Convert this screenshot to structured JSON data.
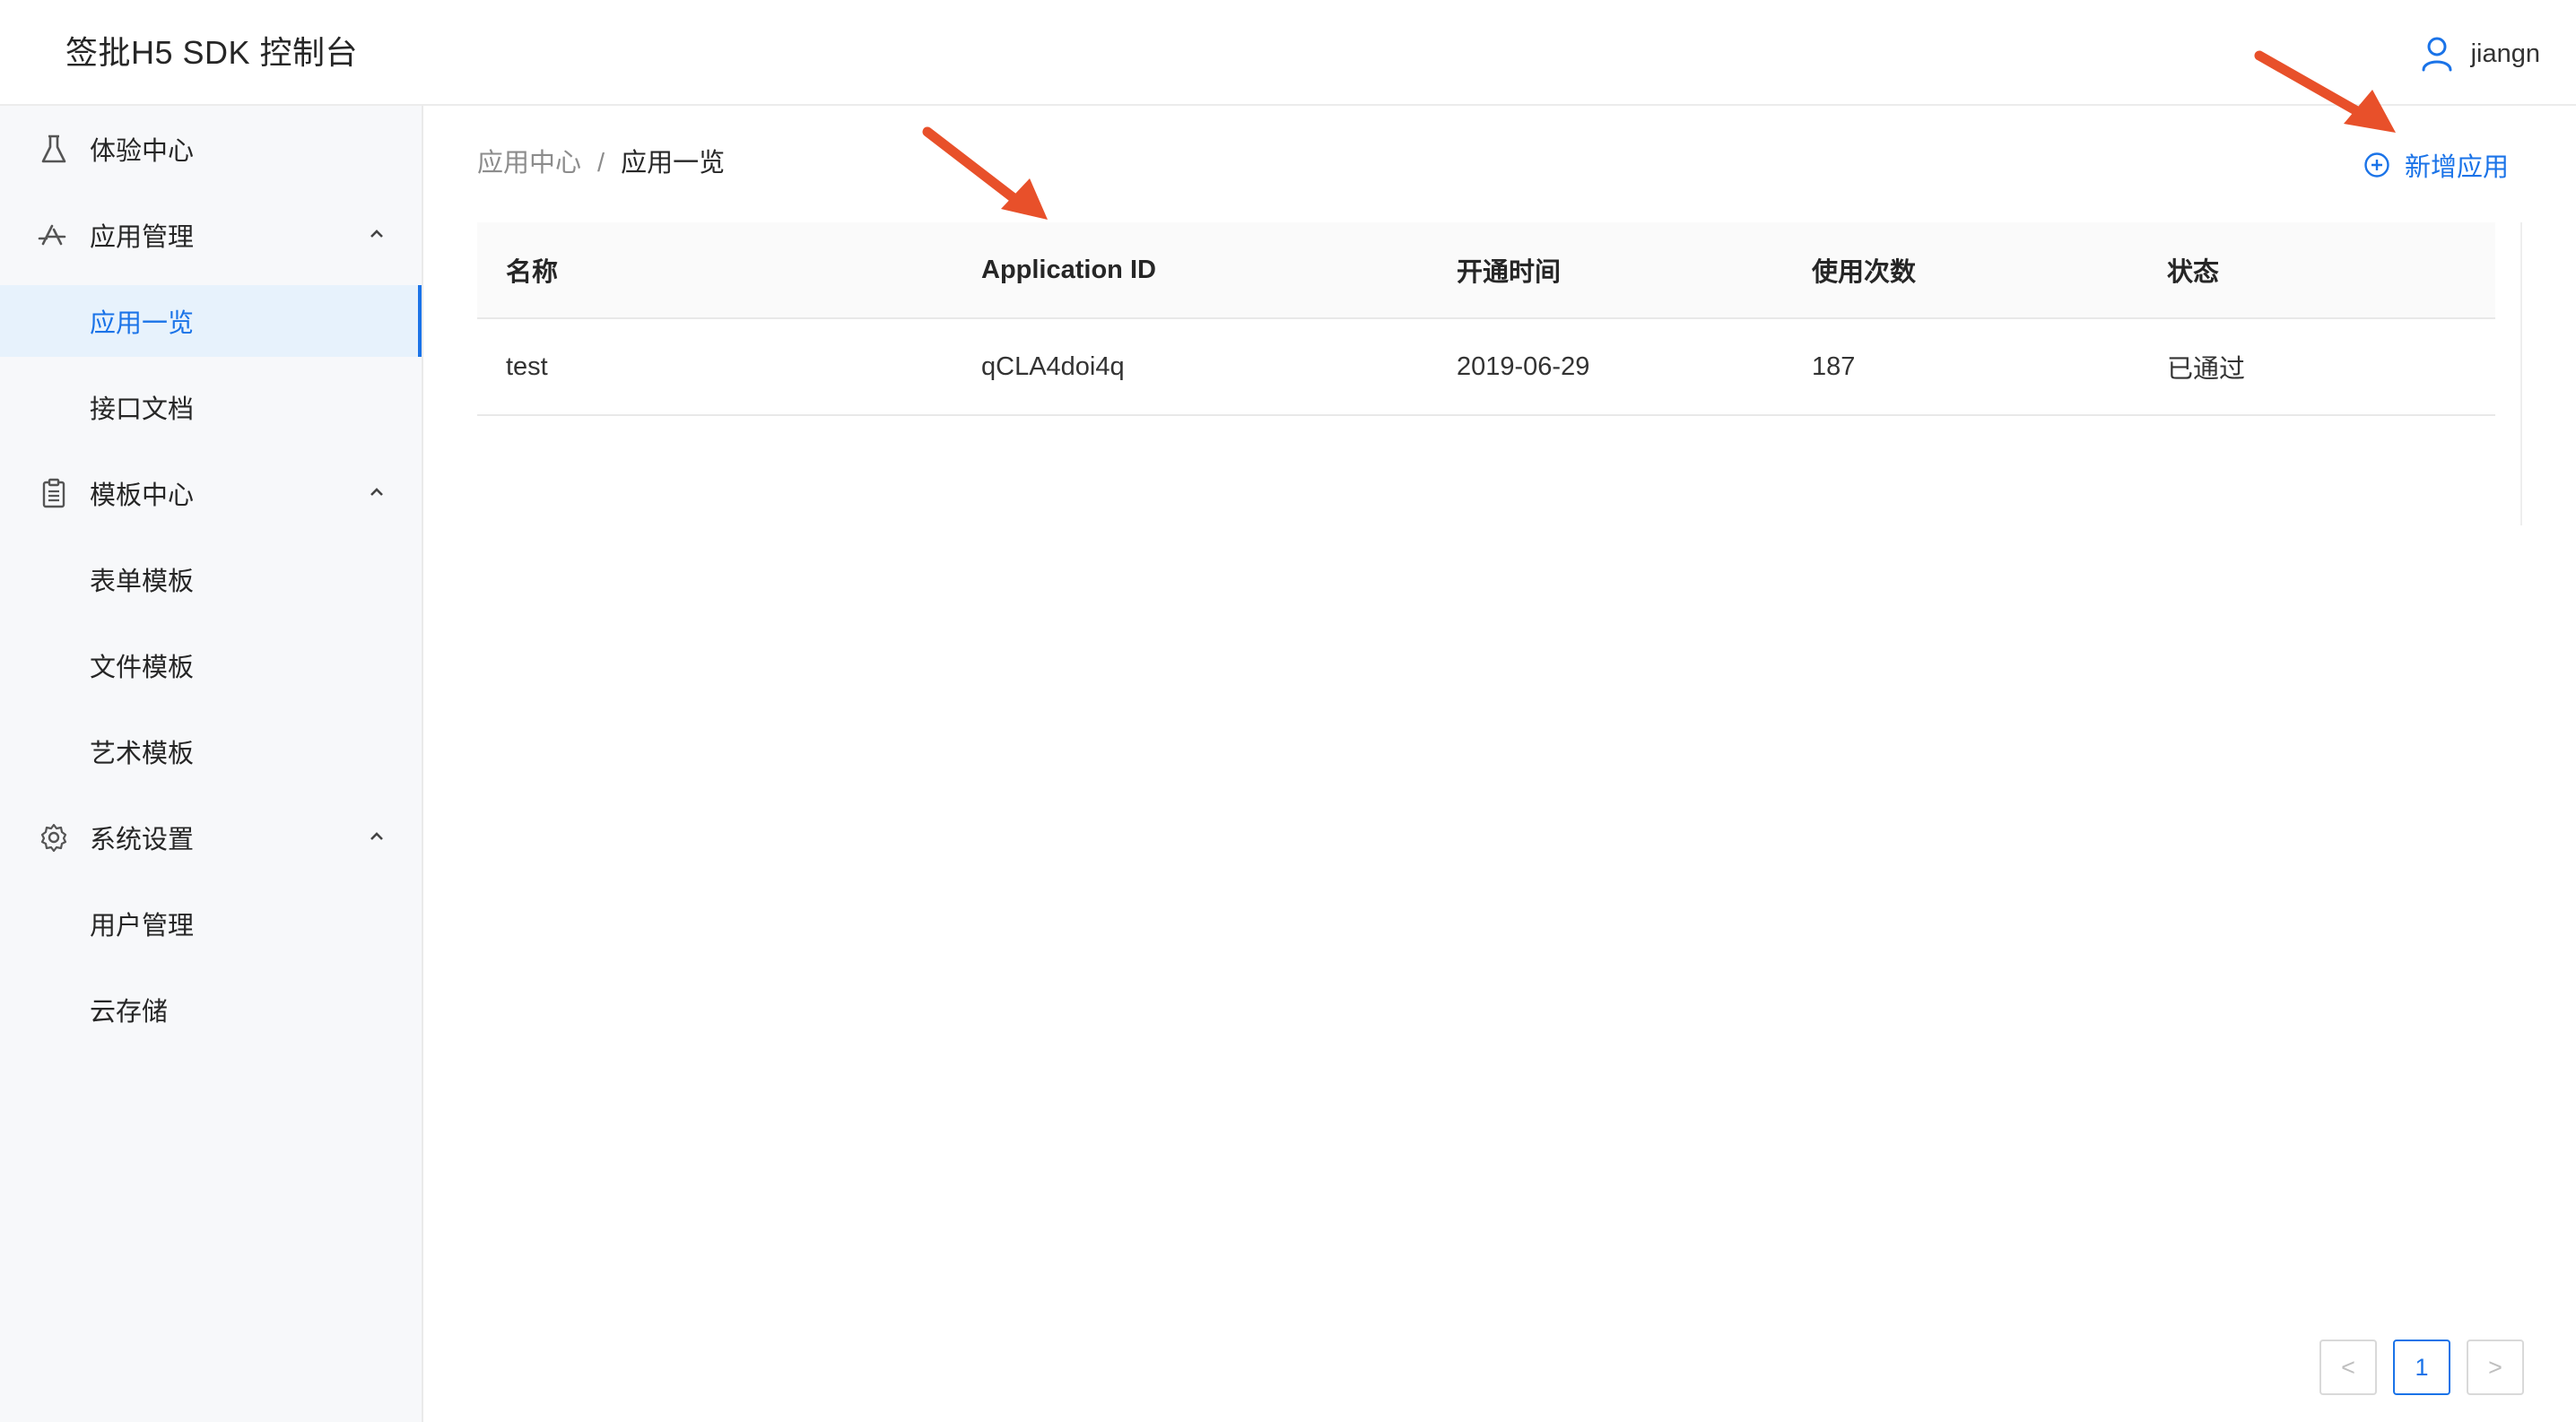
{
  "header": {
    "title": "签批H5 SDK 控制台",
    "username": "jiangn"
  },
  "sidebar": {
    "items": [
      {
        "label": "体验中心",
        "icon": "flask-icon"
      },
      {
        "label": "应用管理",
        "icon": "app-store-icon"
      },
      {
        "label": "应用一览"
      },
      {
        "label": "接口文档"
      },
      {
        "label": "模板中心",
        "icon": "clipboard-icon"
      },
      {
        "label": "表单模板"
      },
      {
        "label": "文件模板"
      },
      {
        "label": "艺术模板"
      },
      {
        "label": "系统设置",
        "icon": "gear-icon"
      },
      {
        "label": "用户管理"
      },
      {
        "label": "云存储"
      }
    ]
  },
  "breadcrumb": {
    "parent": "应用中心",
    "separator": "/",
    "current": "应用一览"
  },
  "toolbar": {
    "add_label": "新增应用"
  },
  "table": {
    "columns": [
      "名称",
      "Application ID",
      "开通时间",
      "使用次数",
      "状态"
    ],
    "rows": [
      [
        "test",
        "qCLA4doi4q",
        "2019-06-29",
        "187",
        "已通过"
      ]
    ]
  },
  "pagination": {
    "prev": "<",
    "current": "1",
    "next": ">"
  },
  "colors": {
    "accent": "#1a73e8",
    "annotation_arrow": "#e8502a",
    "sidebar_bg": "#f7f8fa"
  }
}
